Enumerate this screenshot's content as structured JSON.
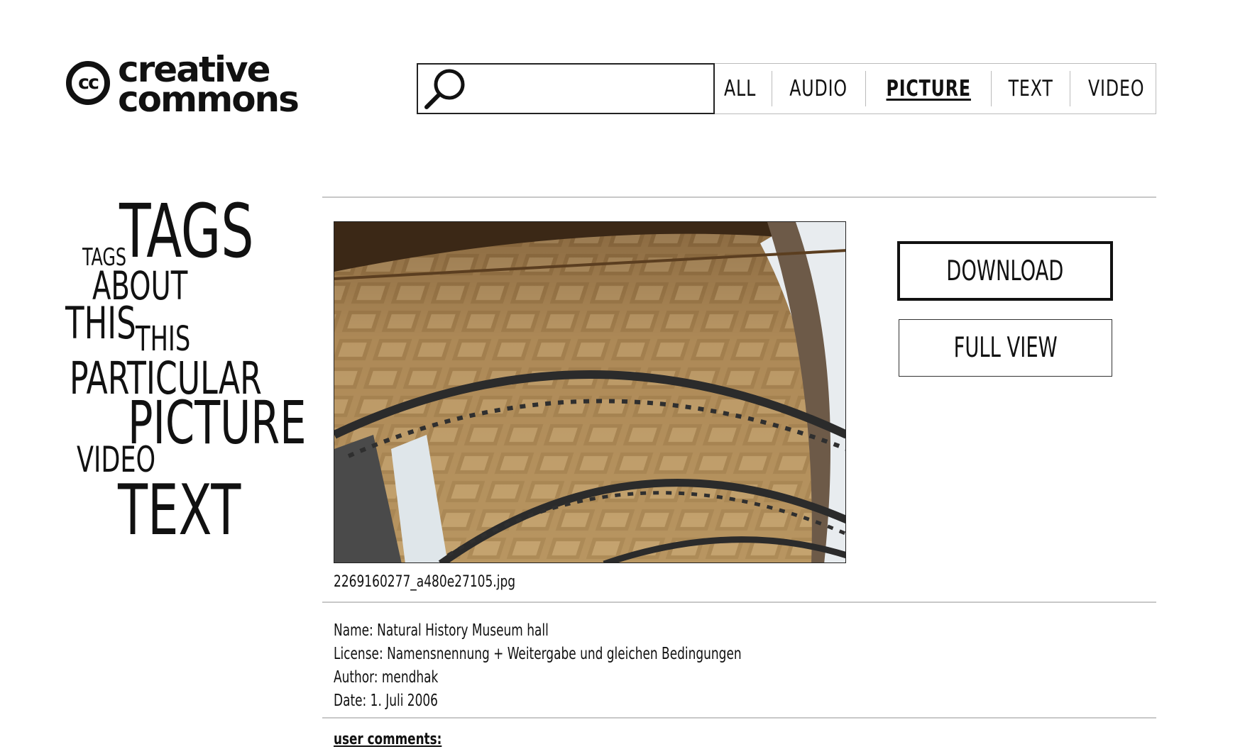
{
  "logo": {
    "mark": "cc",
    "line1": "creative",
    "line2": "commons"
  },
  "search": {
    "value": "",
    "icon": "search-icon"
  },
  "nav": {
    "items": [
      {
        "label": "ALL",
        "active": false
      },
      {
        "label": "AUDIO",
        "active": false
      },
      {
        "label": "PICTURE",
        "active": true
      },
      {
        "label": "TEXT",
        "active": false
      },
      {
        "label": "VIDEO",
        "active": false
      }
    ]
  },
  "tags": [
    {
      "label": "TAGS"
    },
    {
      "label": "TAGS"
    },
    {
      "label": "ABOUT"
    },
    {
      "label": "THIS"
    },
    {
      "label": "THIS"
    },
    {
      "label": "PARTICULAR"
    },
    {
      "label": "PICTURE"
    },
    {
      "label": "VIDEO"
    },
    {
      "label": "TEXT"
    }
  ],
  "picture": {
    "filename": "2269160277_a480e27105.jpg"
  },
  "actions": {
    "download": "DOWNLOAD",
    "full_view": "FULL VIEW"
  },
  "meta": {
    "name": "Name: Natural History Museum hall",
    "license": "License: Namensnennung + Weitergabe und gleichen Bedingungen",
    "author": "Author: mendhak",
    "date": "Date: 1. Juli 2006"
  },
  "comments": {
    "label": "user comments:"
  }
}
